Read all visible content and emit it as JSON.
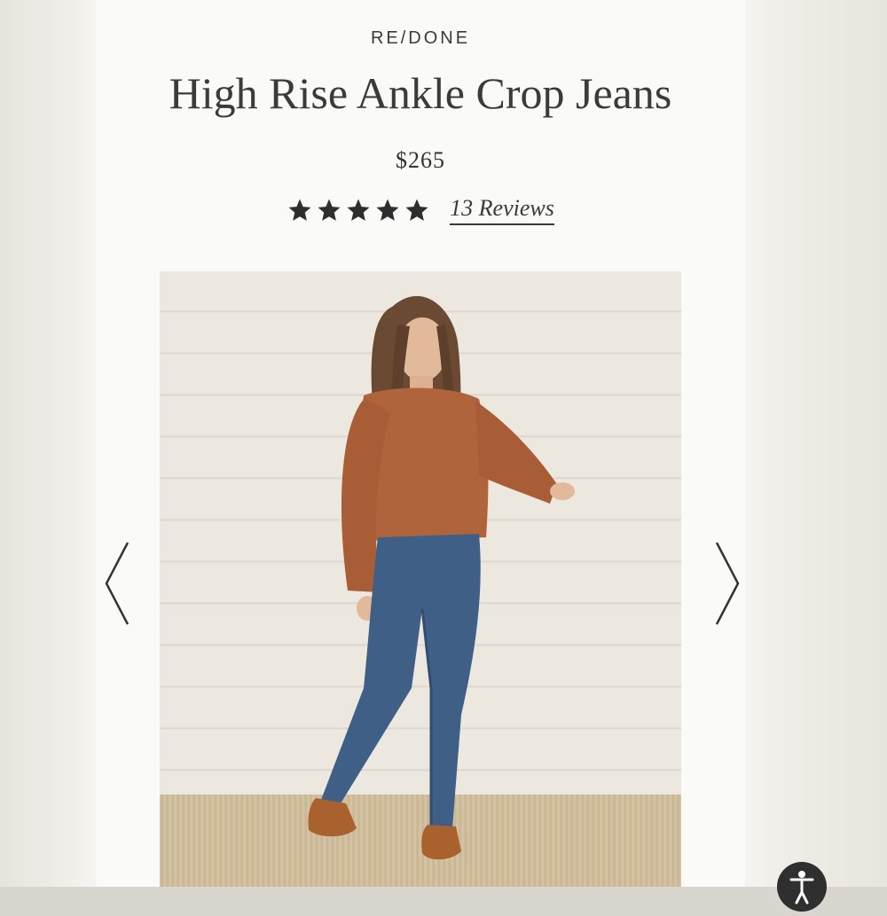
{
  "product": {
    "brand": "RE/DONE",
    "title": "High Rise Ankle Crop Jeans",
    "price": "$265",
    "rating": 5,
    "rating_max": 5,
    "reviews_label": "13 Reviews"
  },
  "gallery": {
    "prev_icon": "chevron-left-icon",
    "next_icon": "chevron-right-icon"
  },
  "colors": {
    "sweater": "#b0643c",
    "denim": "#3f5f86",
    "shoes": "#a9622e"
  }
}
